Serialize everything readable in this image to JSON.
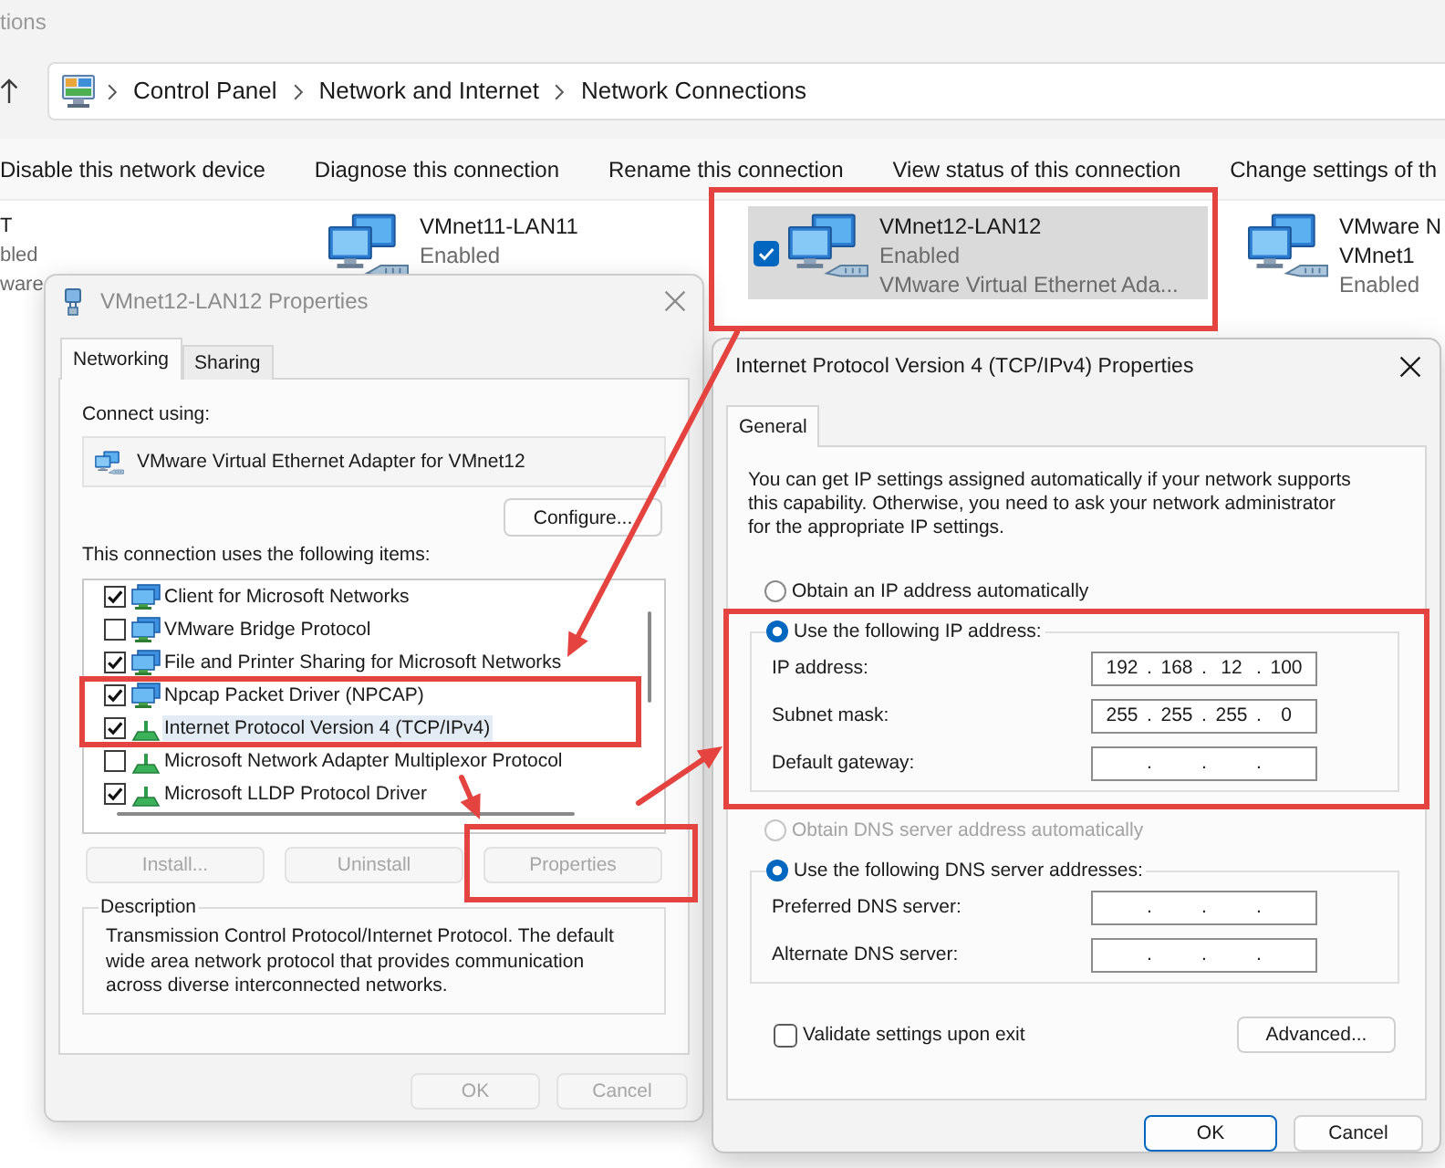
{
  "explorer": {
    "title": "tions",
    "breadcrumb": [
      "Control Panel",
      "Network and Internet",
      "Network Connections"
    ],
    "commands": [
      "Disable this network device",
      "Diagnose this connection",
      "Rename this connection",
      "View status of this connection",
      "Change settings of th"
    ],
    "connections": [
      {
        "kind": "partial",
        "selected": false,
        "name": [
          "T"
        ],
        "details": [
          "bled",
          "ware"
        ]
      },
      {
        "kind": "full",
        "selected": false,
        "name": [
          "VMnet11-LAN11"
        ],
        "details": [
          "Enabled"
        ]
      },
      {
        "kind": "full",
        "selected": true,
        "name": [
          "VMnet12-LAN12"
        ],
        "details": [
          "Enabled",
          "VMware Virtual Ethernet Ada..."
        ]
      },
      {
        "kind": "full",
        "selected": false,
        "name": [
          "VMware N",
          "VMnet1"
        ],
        "details": [
          "Enabled"
        ]
      }
    ]
  },
  "properties_dialog": {
    "title": "VMnet12-LAN12 Properties",
    "active": false,
    "tabs": [
      {
        "label": "Networking",
        "selected": true
      },
      {
        "label": "Sharing",
        "selected": false
      }
    ],
    "connect_using_label": "Connect using:",
    "adapter": "VMware Virtual Ethernet Adapter for VMnet12",
    "configure_button": "Configure...",
    "items_label": "This connection uses the following items:",
    "items": [
      {
        "label": "Client for Microsoft Networks",
        "kind": "service",
        "checked": true,
        "selected": false
      },
      {
        "label": "VMware Bridge Protocol",
        "kind": "service",
        "checked": false,
        "selected": false
      },
      {
        "label": "File and Printer Sharing for Microsoft Networks",
        "kind": "service",
        "checked": true,
        "selected": false
      },
      {
        "label": "Npcap Packet Driver (NPCAP)",
        "kind": "service",
        "checked": true,
        "selected": false
      },
      {
        "label": "Internet Protocol Version 4 (TCP/IPv4)",
        "kind": "protocol",
        "checked": true,
        "selected": true
      },
      {
        "label": "Microsoft Network Adapter Multiplexor Protocol",
        "kind": "protocol",
        "checked": false,
        "selected": false
      },
      {
        "label": "Microsoft LLDP Protocol Driver",
        "kind": "protocol",
        "checked": true,
        "selected": false
      }
    ],
    "buttons": [
      {
        "label": "Install...",
        "disabled": true
      },
      {
        "label": "Uninstall",
        "disabled": true
      },
      {
        "label": "Properties",
        "disabled": true
      }
    ],
    "description": {
      "label": "Description",
      "text": "Transmission Control Protocol/Internet Protocol. The default wide area network protocol that provides communication across diverse interconnected networks."
    },
    "footer_buttons": [
      {
        "label": "OK",
        "disabled": true
      },
      {
        "label": "Cancel",
        "disabled": true
      }
    ]
  },
  "ipv4_dialog": {
    "title": "Internet Protocol Version 4 (TCP/IPv4) Properties",
    "active": true,
    "tabs": [
      {
        "label": "General",
        "selected": true
      }
    ],
    "intro": "You can get IP settings assigned automatically if your network supports this capability. Otherwise, you need to ask your network administrator for the appropriate IP settings.",
    "ip_settings": {
      "options": [
        {
          "label": "Obtain an IP address automatically",
          "selected": false,
          "disabled": false
        },
        {
          "label": "Use the following IP address:",
          "selected": true,
          "disabled": false
        }
      ],
      "fields": [
        {
          "label": "IP address:",
          "octets": [
            "192",
            "168",
            "12",
            "100"
          ],
          "dots": [
            ".",
            ".",
            "."
          ]
        },
        {
          "label": "Subnet mask:",
          "octets": [
            "255",
            "255",
            "255",
            "0"
          ],
          "dots": [
            ".",
            ".",
            "."
          ]
        },
        {
          "label": "Default gateway:",
          "dots": [
            ".",
            ".",
            "."
          ]
        }
      ]
    },
    "dns_settings": {
      "options": [
        {
          "label": "Obtain DNS server address automatically",
          "selected": false,
          "disabled": true
        },
        {
          "label": "Use the following DNS server addresses:",
          "selected": true,
          "disabled": false
        }
      ],
      "fields": [
        {
          "label": "Preferred DNS server:",
          "dots": [
            ".",
            ".",
            "."
          ]
        },
        {
          "label": "Alternate DNS server:",
          "dots": [
            ".",
            ".",
            "."
          ]
        }
      ]
    },
    "validate": {
      "label": "Validate settings upon exit",
      "checked": false
    },
    "advanced_button": "Advanced...",
    "footer_buttons": [
      {
        "label": "OK",
        "default": true
      },
      {
        "label": "Cancel",
        "default": false
      }
    ]
  }
}
